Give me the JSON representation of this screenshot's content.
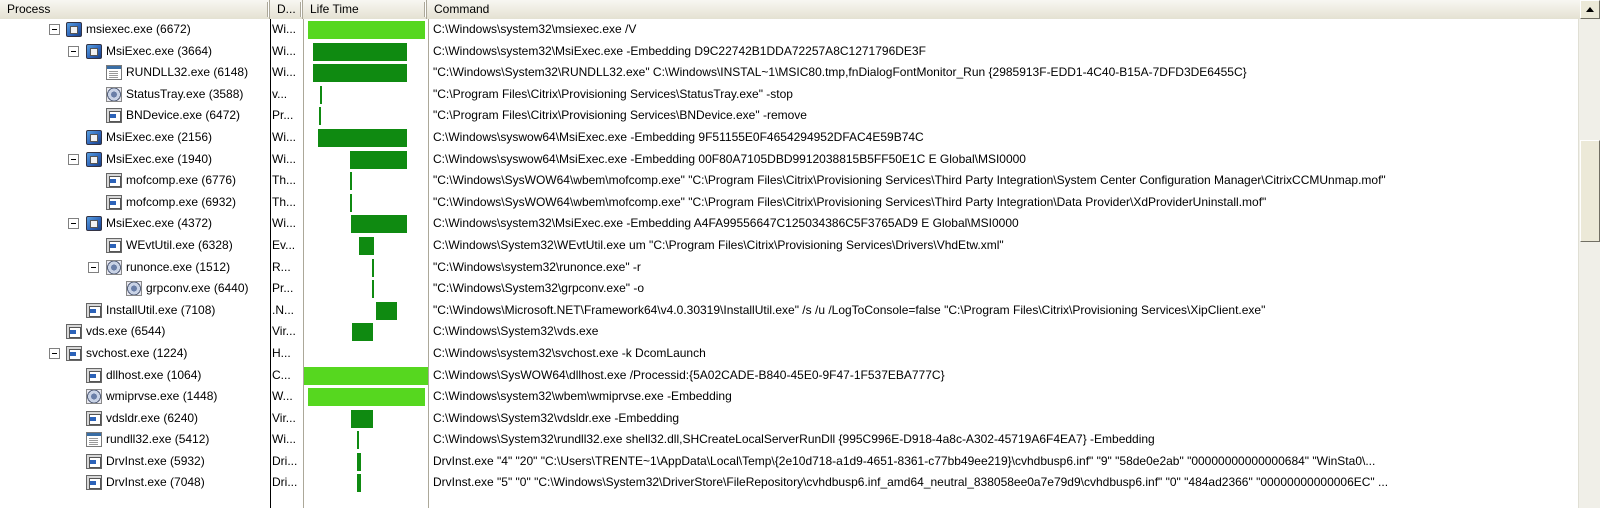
{
  "columns": {
    "process": "Process",
    "desc": "D...",
    "life": "Life Time",
    "command": "Command"
  },
  "rows": [
    {
      "name": "msiexec.exe (6672)",
      "desc": "Wi...",
      "cmd": "C:\\Windows\\system32\\msiexec.exe /V"
    },
    {
      "name": "MsiExec.exe (3664)",
      "desc": "Wi...",
      "cmd": "C:\\Windows\\system32\\MsiExec.exe -Embedding D9C22742B1DDA72257A8C1271796DE3F"
    },
    {
      "name": "RUNDLL32.exe (6148)",
      "desc": "Wi...",
      "cmd": "\"C:\\Windows\\System32\\RUNDLL32.exe\" C:\\Windows\\INSTAL~1\\MSIC80.tmp,fnDialogFontMonitor_Run {2985913F-EDD1-4C40-B15A-7DFD3DE6455C}"
    },
    {
      "name": "StatusTray.exe (3588)",
      "desc": "v...",
      "cmd": "\"C:\\Program Files\\Citrix\\Provisioning Services\\StatusTray.exe\" -stop"
    },
    {
      "name": "BNDevice.exe (6472)",
      "desc": "Pr...",
      "cmd": "\"C:\\Program Files\\Citrix\\Provisioning Services\\BNDevice.exe\" -remove"
    },
    {
      "name": "MsiExec.exe (2156)",
      "desc": "Wi...",
      "cmd": "C:\\Windows\\syswow64\\MsiExec.exe -Embedding 9F51155E0F4654294952DFAC4E59B74C"
    },
    {
      "name": "MsiExec.exe (1940)",
      "desc": "Wi...",
      "cmd": "C:\\Windows\\syswow64\\MsiExec.exe -Embedding 00F80A7105DBD9912038815B5FF50E1C E Global\\MSI0000"
    },
    {
      "name": "mofcomp.exe (6776)",
      "desc": "Th...",
      "cmd": "\"C:\\Windows\\SysWOW64\\wbem\\mofcomp.exe\" \"C:\\Program Files\\Citrix\\Provisioning Services\\Third Party Integration\\System Center Configuration Manager\\CitrixCCMUnmap.mof\""
    },
    {
      "name": "mofcomp.exe (6932)",
      "desc": "Th...",
      "cmd": "\"C:\\Windows\\SysWOW64\\wbem\\mofcomp.exe\" \"C:\\Program Files\\Citrix\\Provisioning Services\\Third Party Integration\\Data Provider\\XdProviderUninstall.mof\""
    },
    {
      "name": "MsiExec.exe (4372)",
      "desc": "Wi...",
      "cmd": "C:\\Windows\\system32\\MsiExec.exe -Embedding A4FA99556647C125034386C5F3765AD9 E Global\\MSI0000"
    },
    {
      "name": "WEvtUtil.exe (6328)",
      "desc": "Ev...",
      "cmd": "C:\\Windows\\System32\\WEvtUtil.exe um \"C:\\Program Files\\Citrix\\Provisioning Services\\Drivers\\VhdEtw.xml\""
    },
    {
      "name": "runonce.exe (1512)",
      "desc": "R...",
      "cmd": "\"C:\\Windows\\system32\\runonce.exe\" -r"
    },
    {
      "name": "grpconv.exe (6440)",
      "desc": "Pr...",
      "cmd": "\"C:\\Windows\\System32\\grpconv.exe\" -o"
    },
    {
      "name": "InstallUtil.exe (7108)",
      "desc": ".N...",
      "cmd": "\"C:\\Windows\\Microsoft.NET\\Framework64\\v4.0.30319\\InstallUtil.exe\" /s /u /LogToConsole=false \"C:\\Program Files\\Citrix\\Provisioning Services\\XipClient.exe\""
    },
    {
      "name": "vds.exe (6544)",
      "desc": "Vir...",
      "cmd": "C:\\Windows\\System32\\vds.exe"
    },
    {
      "name": "svchost.exe (1224)",
      "desc": "H...",
      "cmd": "C:\\Windows\\system32\\svchost.exe -k DcomLaunch"
    },
    {
      "name": "dllhost.exe (1064)",
      "desc": "C...",
      "cmd": "C:\\Windows\\SysWOW64\\dllhost.exe /Processid:{5A02CADE-B840-45E0-9F47-1F537EBA777C}"
    },
    {
      "name": "wmiprvse.exe (1448)",
      "desc": "W...",
      "cmd": "C:\\Windows\\system32\\wbem\\wmiprvse.exe -Embedding"
    },
    {
      "name": "vdsldr.exe (6240)",
      "desc": "Vir...",
      "cmd": "C:\\Windows\\System32\\vdsldr.exe -Embedding"
    },
    {
      "name": "rundll32.exe (5412)",
      "desc": "Wi...",
      "cmd": "C:\\Windows\\System32\\rundll32.exe shell32.dll,SHCreateLocalServerRunDll {995C996E-D918-4a8c-A302-45719A6F4EA7} -Embedding"
    },
    {
      "name": "DrvInst.exe (5932)",
      "desc": "Dri...",
      "cmd": "DrvInst.exe \"4\" \"20\" \"C:\\Users\\TRENTE~1\\AppData\\Local\\Temp\\{2e10d718-a1d9-4651-8361-c77bb49ee219}\\cvhdbusp6.inf\" \"9\" \"58de0e2ab\" \"00000000000000684\" \"WinSta0\\..."
    },
    {
      "name": "DrvInst.exe (7048)",
      "desc": "Dri...",
      "cmd": "DrvInst.exe \"5\" \"0\" \"C:\\Windows\\System32\\DriverStore\\FileRepository\\cvhdbusp6.inf_amd64_neutral_838058ee0a7e79d9\\cvhdbusp6.inf\" \"0\" \"484ad2366\" \"00000000000006EC\" ..."
    }
  ]
}
